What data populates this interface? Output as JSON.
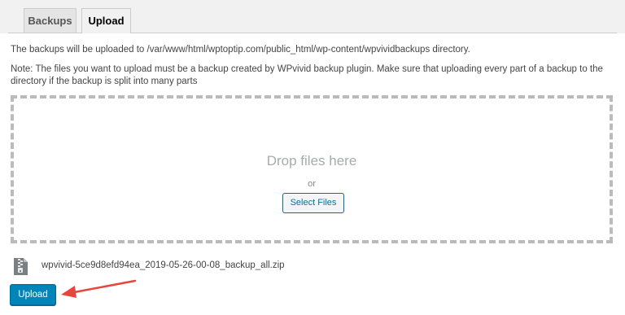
{
  "tabs": [
    {
      "label": "Backups",
      "active": false
    },
    {
      "label": "Upload",
      "active": true
    }
  ],
  "upload_info": "The backups will be uploaded to /var/www/html/wptoptip.com/public_html/wp-content/wpvividbackups directory.",
  "note": "Note: The files you want to upload must be a backup created by WPvivid backup plugin. Make sure that uploading every part of a backup to the directory if the backup is split into many parts",
  "dropzone": {
    "title": "Drop files here",
    "or": "or",
    "select_label": "Select Files"
  },
  "file": {
    "icon": "zip-file-icon",
    "name": "wpvivid-5ce9d8efd94ea_2019-05-26-00-08_backup_all.zip"
  },
  "upload_button": "Upload",
  "colors": {
    "primary": "#0085ba",
    "arrow": "#e8453c"
  }
}
